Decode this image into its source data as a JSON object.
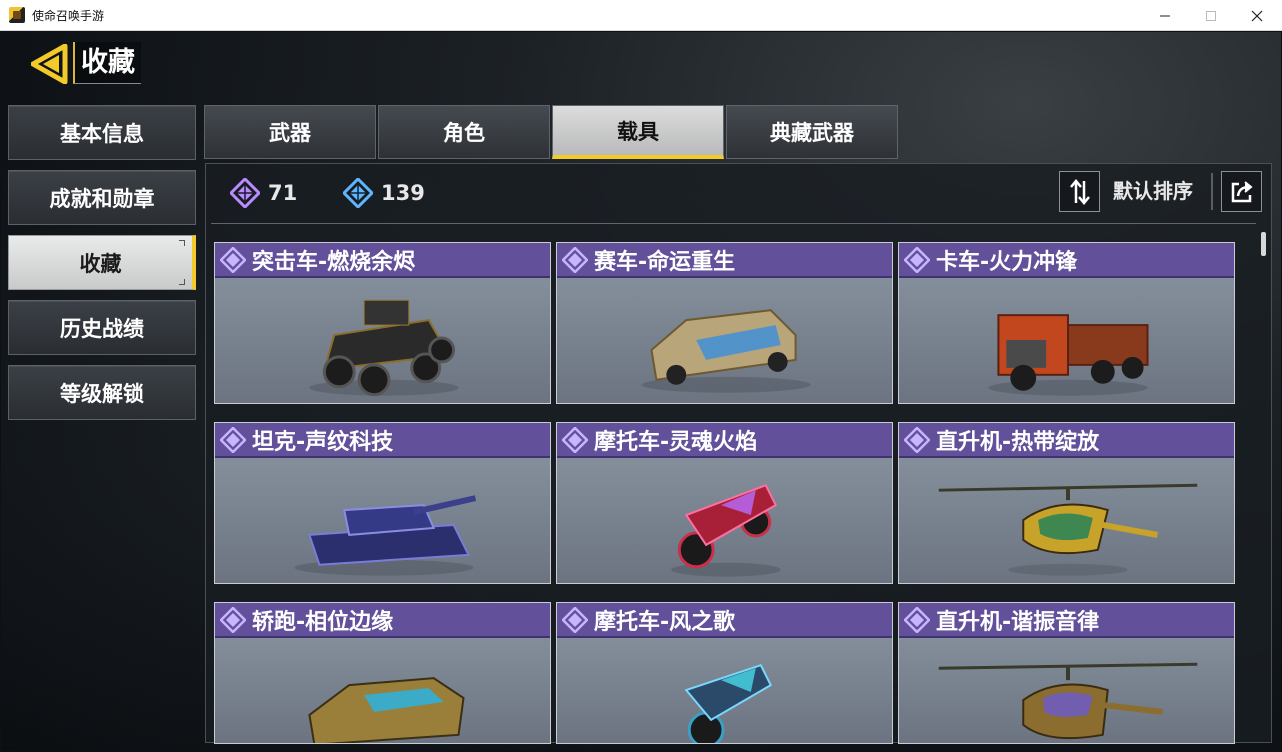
{
  "window": {
    "title": "使命召唤手游"
  },
  "header": {
    "title": "收藏"
  },
  "sidebar": {
    "items": [
      {
        "label": "基本信息",
        "active": false
      },
      {
        "label": "成就和勋章",
        "active": false
      },
      {
        "label": "收藏",
        "active": true
      },
      {
        "label": "历史战绩",
        "active": false
      },
      {
        "label": "等级解锁",
        "active": false
      }
    ]
  },
  "tabs": [
    {
      "label": "武器",
      "active": false
    },
    {
      "label": "角色",
      "active": false
    },
    {
      "label": "载具",
      "active": true
    },
    {
      "label": "典藏武器",
      "active": false
    }
  ],
  "stats": {
    "epic": {
      "icon": "purple-gem-icon",
      "value": "71",
      "color": "#b68cff"
    },
    "rare": {
      "icon": "blue-gem-icon",
      "value": "139",
      "color": "#5fb6ff"
    }
  },
  "sort": {
    "label": "默认排序"
  },
  "colors": {
    "accent": "#f2cb2a",
    "card_header": "#62519a",
    "epic_gem": "#b68cff",
    "rare_gem": "#5fb6ff"
  },
  "vehicles": [
    {
      "name": "突击车-燃烧余烬",
      "kind": "buggy"
    },
    {
      "name": "赛车-命运重生",
      "kind": "car"
    },
    {
      "name": "卡车-火力冲锋",
      "kind": "truck"
    },
    {
      "name": "坦克-声纹科技",
      "kind": "tank"
    },
    {
      "name": "摩托车-灵魂火焰",
      "kind": "bike"
    },
    {
      "name": "直升机-热带绽放",
      "kind": "heli"
    },
    {
      "name": "轿跑-相位边缘",
      "kind": "sportscar"
    },
    {
      "name": "摩托车-风之歌",
      "kind": "bike2"
    },
    {
      "name": "直升机-谐振音律",
      "kind": "heli2"
    }
  ]
}
